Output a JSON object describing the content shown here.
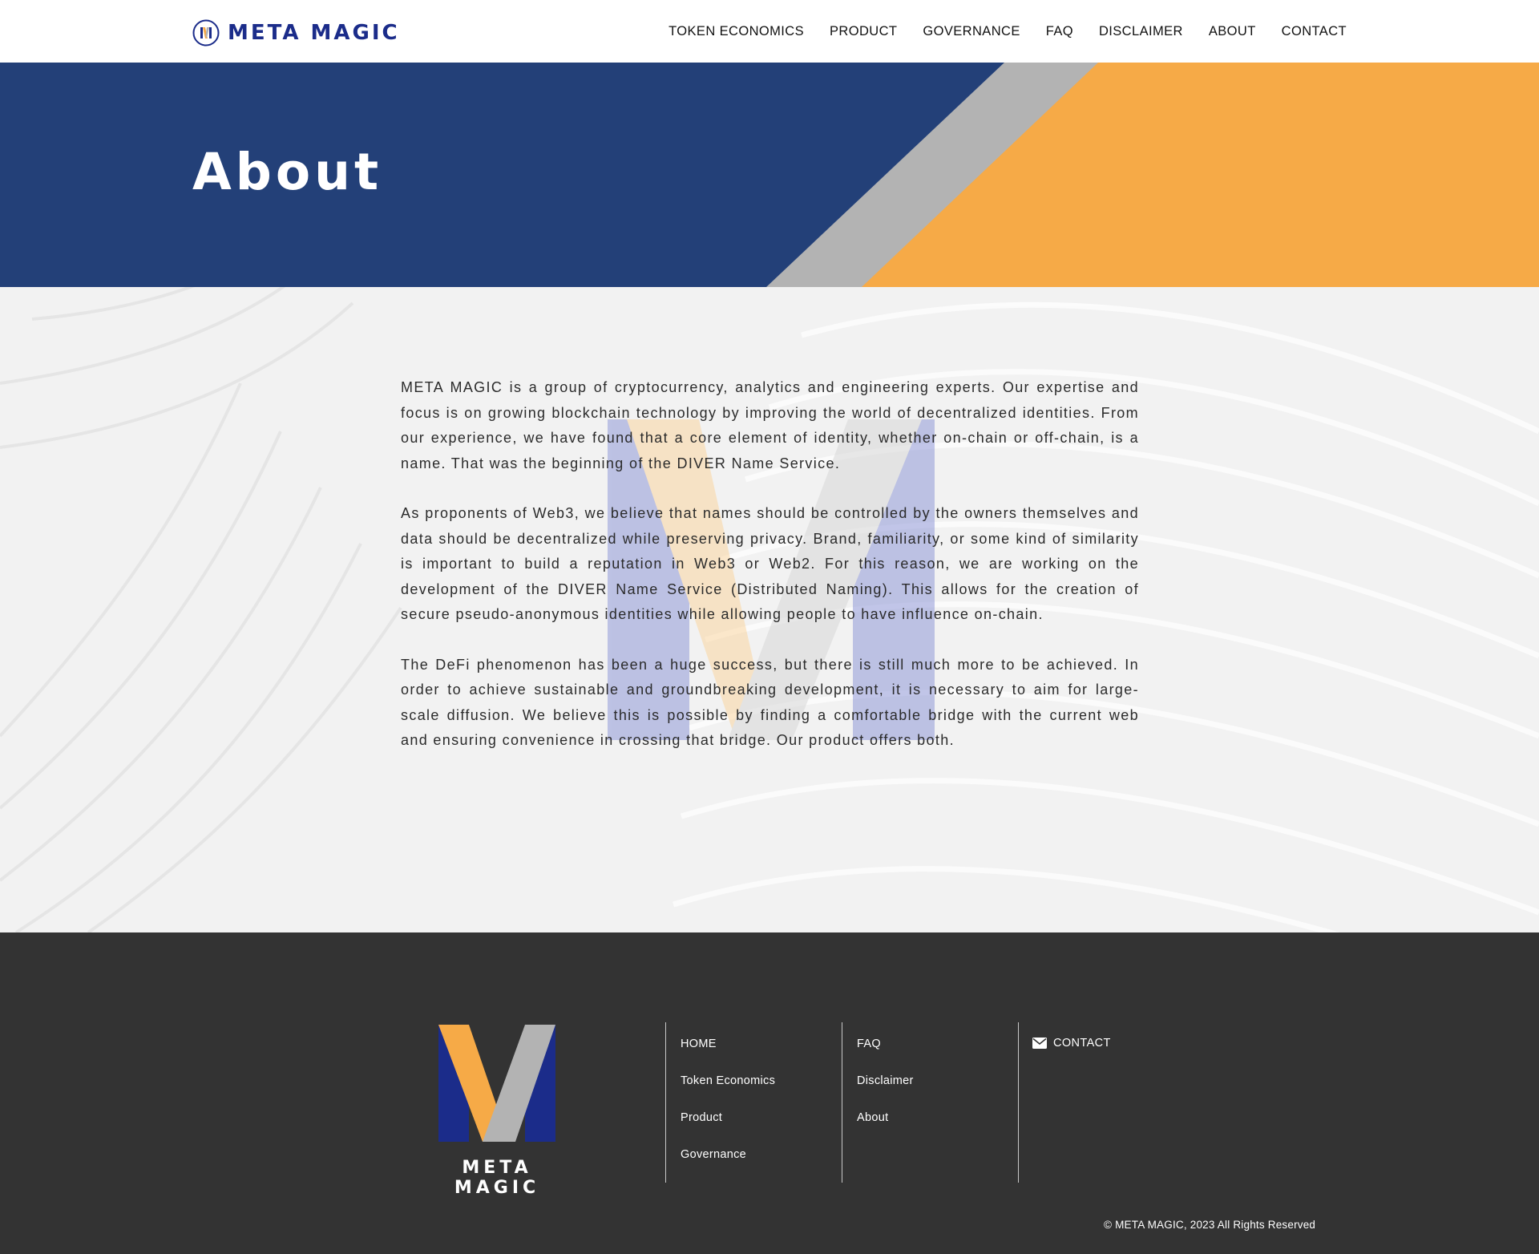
{
  "header": {
    "brand_name": "META MAGIC",
    "nav": [
      "TOKEN ECONOMICS",
      "PRODUCT",
      "GOVERNANCE",
      "FAQ",
      "DISCLAIMER",
      "ABOUT",
      "CONTACT"
    ]
  },
  "hero": {
    "title": "About"
  },
  "content": {
    "paragraphs": [
      "META MAGIC is a group of cryptocurrency, analytics and engineering experts. Our expertise and focus is on growing blockchain technology by improving the world of decentralized identities. From our experience, we have found that a core element of identity, whether on-chain or off-chain, is a name. That was the beginning of the DIVER Name Service.",
      "As proponents of Web3, we believe that names should be controlled by the owners themselves and data should be decentralized while preserving privacy. Brand, familiarity, or some kind of similarity is important to build a reputation in Web3 or Web2. For this reason, we are working on the development of the DIVER Name Service (Distributed Naming). This allows for the creation of secure pseudo-anonymous identities while allowing people to have influence on-chain.",
      "The DeFi phenomenon has been a huge success, but there is still much more to be achieved. In order to achieve sustainable and groundbreaking development, it is necessary to aim for large-scale diffusion. We believe this is possible by finding a comfortable bridge with the current web and ensuring convenience in crossing that bridge. Our product offers both."
    ]
  },
  "footer": {
    "logo_text": "META MAGIC",
    "col1": [
      "HOME",
      "Token Economics",
      "Product",
      "Governance"
    ],
    "col2": [
      "FAQ",
      "Disclaimer",
      "About"
    ],
    "contact_label": "CONTACT",
    "copyright": "© META MAGIC, 2023 All Rights Reserved"
  },
  "colors": {
    "brand_navy": "#1b2c8a",
    "hero_blue": "#234078",
    "gray_stripe": "#b3b3b3",
    "accent_orange": "#f6aa47",
    "footer_bg": "#333333"
  },
  "icons": [
    "brand-logo-icon",
    "envelope-icon"
  ]
}
